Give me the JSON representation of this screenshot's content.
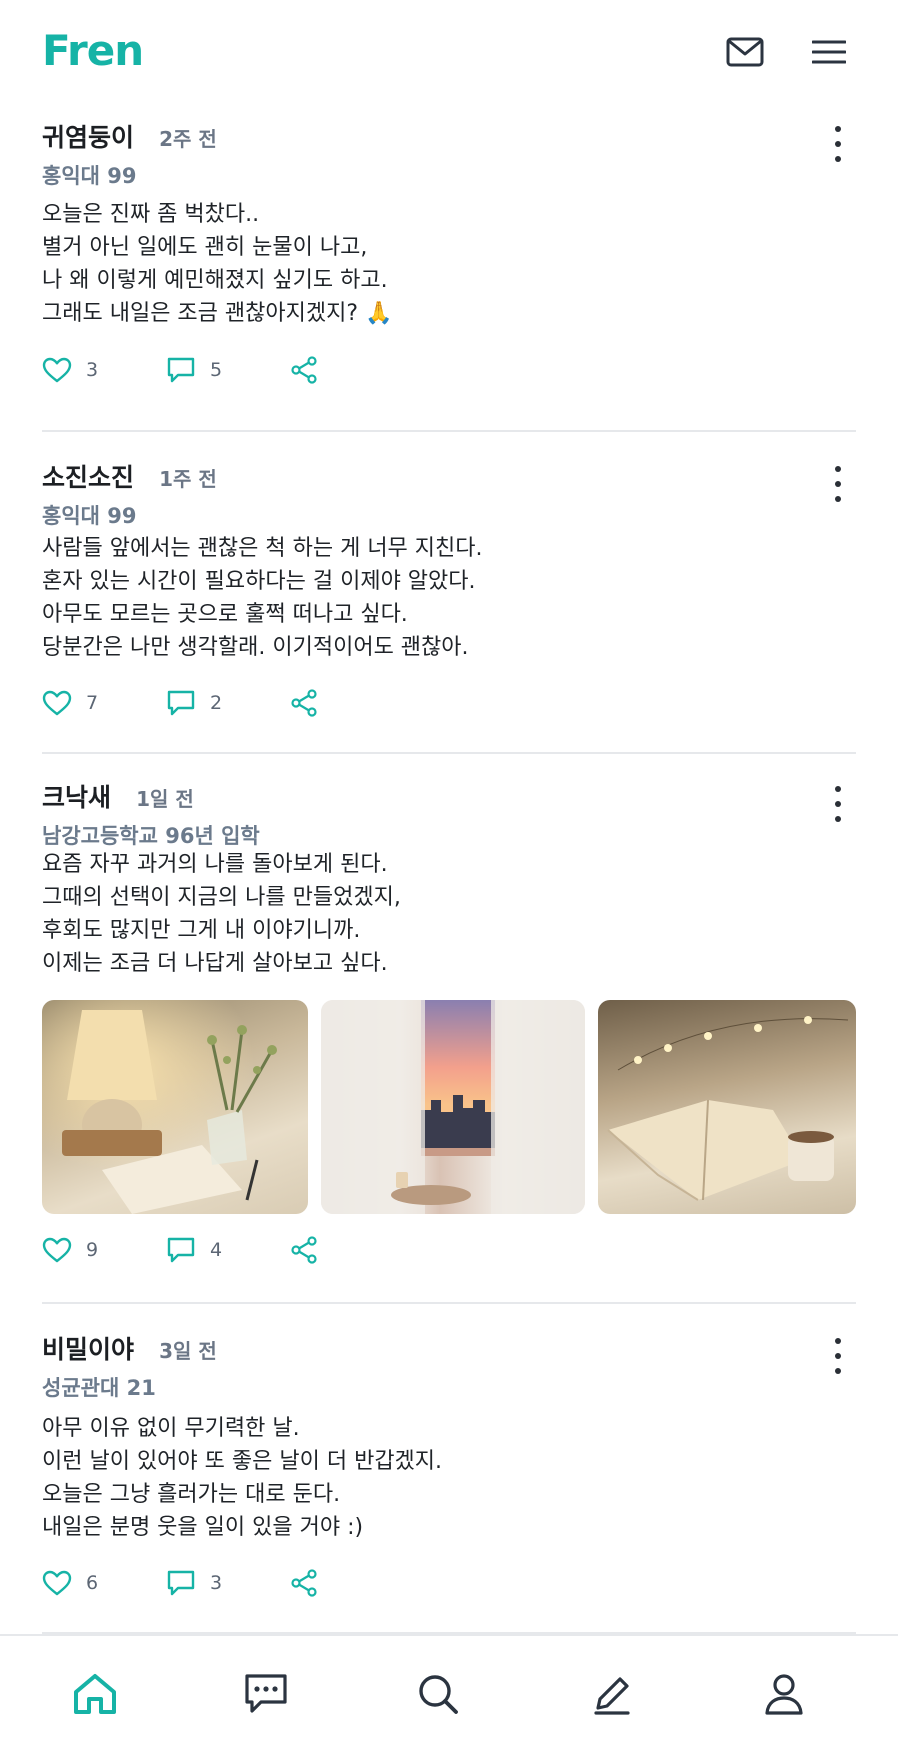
{
  "app": {
    "name": "Fren",
    "brand_color": "#16b3a6"
  },
  "header": {
    "mail_icon": "mail-icon",
    "menu_icon": "menu-icon"
  },
  "posts": [
    {
      "author": "귀염둥이",
      "time": "2주 전",
      "affiliation": "홍익대 99",
      "lines": [
        "오늘은 진짜 좀 벅찼다..",
        "별거 아닌 일에도 괜히 눈물이 나고,",
        "나 왜 이렇게 예민해졌지 싶기도 하고.",
        "그래도 내일은 조금 괜찮아지겠지? 🙏"
      ],
      "likes": "3",
      "comments": "5"
    },
    {
      "author": "소진소진",
      "time": "1주 전",
      "affiliation": "홍익대 99",
      "lines": [
        "사람들 앞에서는 괜찮은 척 하는 게 너무 지친다.",
        "혼자 있는 시간이 필요하다는 걸 이제야 알았다.",
        "아무도 모르는 곳으로 훌쩍 떠나고 싶다.",
        "당분간은 나만 생각할래. 이기적이어도 괜찮아."
      ],
      "likes": "7",
      "comments": "2"
    },
    {
      "author": "크낙새",
      "time": "1일 전",
      "affiliation": "남강고등학교 96년 입학",
      "lines": [
        "요즘 자꾸 과거의 나를 돌아보게 된다.",
        "그때의 선택이 지금의 나를 만들었겠지,",
        "후회도 많지만 그게 내 이야기니까.",
        "이제는 조금 더 나답게 살아보고 싶다."
      ],
      "likes": "9",
      "comments": "4",
      "images": [
        "lamp-desk-photo",
        "sunset-window-photo",
        "book-bed-photo"
      ]
    },
    {
      "author": "비밀이야",
      "time": "3일 전",
      "affiliation": "성균관대 21",
      "lines": [
        "아무 이유 없이 무기력한 날.",
        "이런 날이 있어야 또 좋은 날이 더 반갑겠지.",
        "오늘은 그냥 흘러가는 대로 둔다.",
        "내일은 분명 웃을 일이 있을 거야 :)"
      ],
      "likes": "6",
      "comments": "3"
    }
  ],
  "tabbar": {
    "active": "home",
    "tabs": [
      "home-icon",
      "chat-icon",
      "search-icon",
      "write-icon",
      "profile-icon"
    ]
  }
}
